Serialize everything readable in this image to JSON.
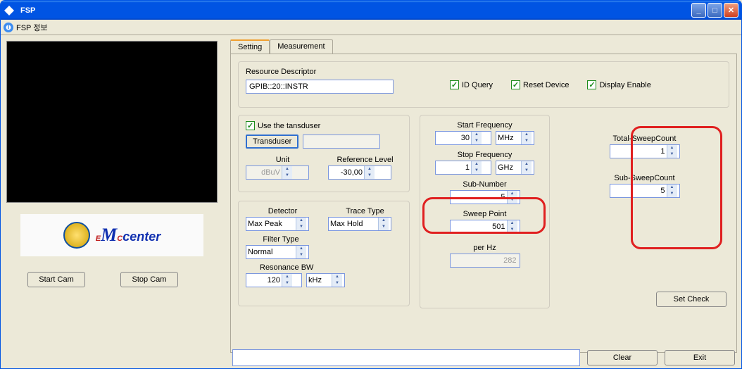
{
  "titlebar": {
    "title": "FSP"
  },
  "menubar": {
    "info_label": "FSP 정보"
  },
  "cam": {
    "start": "Start Cam",
    "stop": "Stop Cam"
  },
  "tabs": {
    "setting": "Setting",
    "measurement": "Measurement"
  },
  "rd": {
    "label": "Resource Descriptor",
    "value": "GPIB::20::INSTR",
    "id_query": "ID Query",
    "reset_device": "Reset Device",
    "display_enable": "Display Enable"
  },
  "transducer": {
    "use_label": "Use the tansduser",
    "btn": "Transduser",
    "file": "",
    "unit_lbl": "Unit",
    "unit_val": "dBuV",
    "ref_lbl": "Reference Level",
    "ref_val": "-30,00"
  },
  "detect": {
    "detector_lbl": "Detector",
    "detector_val": "Max Peak",
    "trace_lbl": "Trace Type",
    "trace_val": "Max Hold",
    "filter_lbl": "Filter Type",
    "filter_val": "Normal",
    "rbw_lbl": "Resonance BW",
    "rbw_val": "120",
    "rbw_unit": "kHz"
  },
  "freq": {
    "start_lbl": "Start Frequency",
    "start_val": "30",
    "start_unit": "MHz",
    "stop_lbl": "Stop Frequency",
    "stop_val": "1",
    "stop_unit": "GHz",
    "subnum_lbl": "Sub-Number",
    "subnum_val": "5",
    "sweep_lbl": "Sweep Point",
    "sweep_val": "501",
    "perhz_lbl": "per Hz",
    "perhz_val": "282"
  },
  "counts": {
    "total_lbl": "Total-SweepCount",
    "total_val": "1",
    "sub_lbl": "Sub-SweepCount",
    "sub_val": "5"
  },
  "buttons": {
    "set_check": "Set Check",
    "clear": "Clear",
    "exit": "Exit"
  }
}
